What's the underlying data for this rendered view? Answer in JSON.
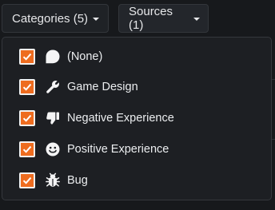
{
  "filters": {
    "categories_label": "Categories (5)",
    "sources_label": "Sources (1)"
  },
  "dropdown": {
    "items": [
      {
        "label": "(None)",
        "icon": "speech-bubble-icon",
        "checked": true
      },
      {
        "label": "Game Design",
        "icon": "wrench-icon",
        "checked": true
      },
      {
        "label": "Negative Experience",
        "icon": "thumbs-down-icon",
        "checked": true
      },
      {
        "label": "Positive Experience",
        "icon": "smiley-icon",
        "checked": true
      },
      {
        "label": "Bug",
        "icon": "bug-icon",
        "checked": true
      }
    ]
  },
  "colors": {
    "accent": "#ee6c1f",
    "background": "#17191c",
    "panel": "#1d1f23",
    "text": "#eceef0"
  }
}
